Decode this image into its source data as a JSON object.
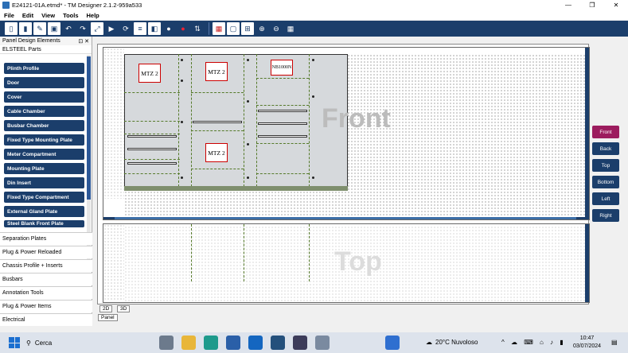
{
  "window": {
    "title": "E24121-01A.etmd* - TM Designer 2.1.2-959a533",
    "controls": [
      "—",
      "❐",
      "✕"
    ]
  },
  "menu": [
    "File",
    "Edit",
    "View",
    "Tools",
    "Help"
  ],
  "toolbar_icons": [
    "new-icon",
    "open-icon",
    "pen-icon",
    "save-icon",
    "undo-icon",
    "redo-icon",
    "export-icon",
    "run-icon",
    "refresh-icon",
    "list-icon",
    "layers-icon",
    "bulb-icon",
    "alert-icon",
    "sort-icon",
    "color-icon",
    "panel-icon",
    "grid-icon",
    "zoom-in-icon",
    "zoom-out-icon",
    "fit-icon"
  ],
  "left_panel": {
    "header": "Panel Design Elements",
    "section": "ELSTEEL Parts",
    "parts": [
      "Plinth Profile",
      "Door",
      "Cover",
      "Cable Chamber",
      "Busbar Chamber",
      "Fixed Type Mounting Plate",
      "Meter Compartment",
      "Mounting Plate",
      "Din Insert",
      "Fixed Type Compartment",
      "External Gland Plate",
      "Steel Blank Front Plate"
    ],
    "categories": [
      "Separation Plates",
      "Plug & Power Reloaded",
      "Chassis Profile + Inserts",
      "Busbars",
      "Annotation Tools",
      "Plug & Power Items",
      "Electrical"
    ]
  },
  "canvas": {
    "front_label": "Front",
    "top_label": "Top",
    "components": [
      "MTZ 2",
      "MTZ 2",
      "NB1000N",
      "MTZ 2"
    ]
  },
  "view_buttons": [
    "Front",
    "Back",
    "Top",
    "Bottom",
    "Left",
    "Right"
  ],
  "bottom_tabs": [
    "2D",
    "3D",
    "Panel"
  ],
  "taskbar": {
    "search": "Cerca",
    "weather": "20°C  Nuvoloso",
    "time": "10:47",
    "date": "03/07/2024",
    "colors": {
      "accent": "#1b3e6b",
      "active": "#9c1c5e"
    }
  }
}
